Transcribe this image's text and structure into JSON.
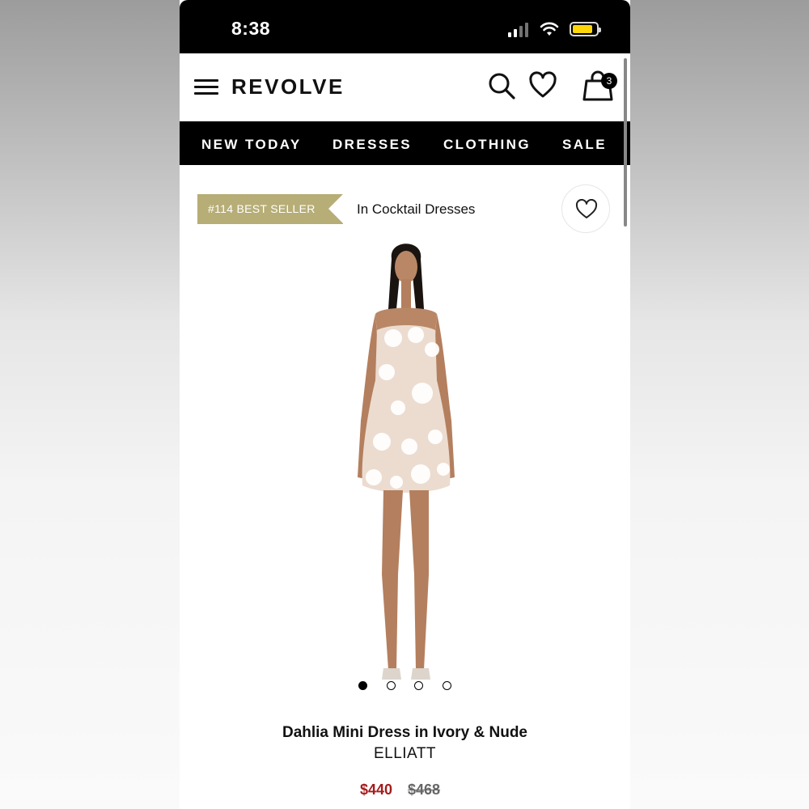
{
  "status_bar": {
    "time": "8:38"
  },
  "header": {
    "logo": "REVOLVE",
    "bag_count": "3"
  },
  "nav": {
    "items": [
      "NEW TODAY",
      "DRESSES",
      "CLOTHING",
      "SALE"
    ]
  },
  "product": {
    "best_seller_badge": "#114 BEST SELLER",
    "category": "In Cocktail Dresses",
    "name": "Dahlia Mini Dress in Ivory & Nude",
    "brand": "ELLIATT",
    "sale_price": "$440",
    "original_price": "$468",
    "image_count": 4,
    "active_image_index": 0
  },
  "colors": {
    "badge": "#b7ad76",
    "sale_price": "#a51b1b",
    "battery": "#ffd60a"
  }
}
